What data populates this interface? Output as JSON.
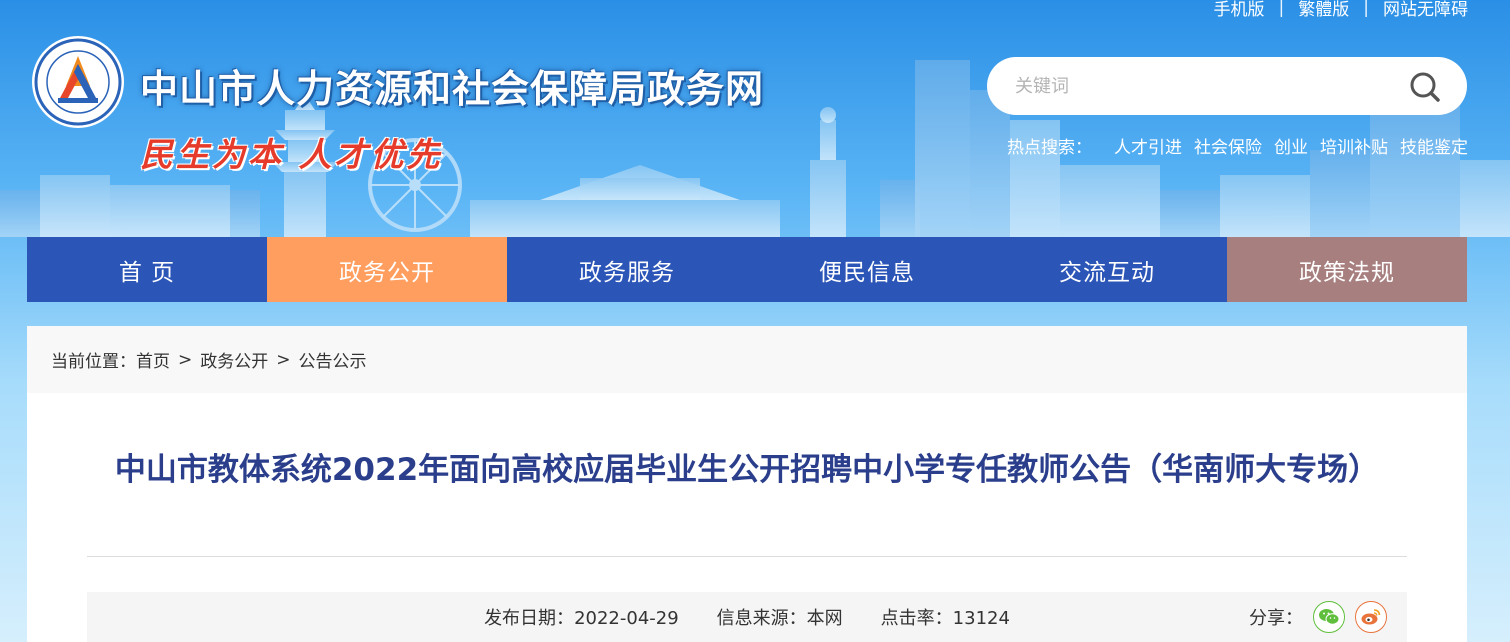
{
  "top_links": [
    "手机版",
    "繁體版",
    "网站无障碍"
  ],
  "site_title": "中山市人力资源和社会保障局政务网",
  "slogan": "民生为本 人才优先",
  "search": {
    "placeholder": "关键词"
  },
  "hot_search": {
    "label": "热点搜索：",
    "items": [
      "人才引进",
      "社会保险",
      "创业",
      "培训补贴",
      "技能鉴定"
    ]
  },
  "nav": {
    "items": [
      {
        "label": "首 页"
      },
      {
        "label": "政务公开",
        "active": true
      },
      {
        "label": "政务服务"
      },
      {
        "label": "便民信息"
      },
      {
        "label": "交流互动"
      },
      {
        "label": "政策法规"
      }
    ]
  },
  "breadcrumb": {
    "prefix": "当前位置：",
    "items": [
      "首页",
      "政务公开",
      "公告公示"
    ],
    "separator": ">"
  },
  "article": {
    "title": "中山市教体系统2022年面向高校应届毕业生公开招聘中小学专任教师公告（华南师大专场）",
    "publish_label": "发布日期：",
    "publish_date": "2022-04-29",
    "source_label": "信息来源：",
    "source": "本网",
    "clicks_label": "点击率：",
    "clicks": "13124",
    "share_label": "分享："
  },
  "colors": {
    "nav_default": "#2c55b8",
    "nav_active": "#ff9e5f",
    "nav_policy": "#a77f7f",
    "title_blue": "#2a3e8c",
    "slogan_red": "#e63b2a"
  },
  "icons": {
    "search": "search-icon",
    "wechat": "wechat-icon",
    "weibo": "weibo-icon",
    "logo": "logo-emblem"
  }
}
